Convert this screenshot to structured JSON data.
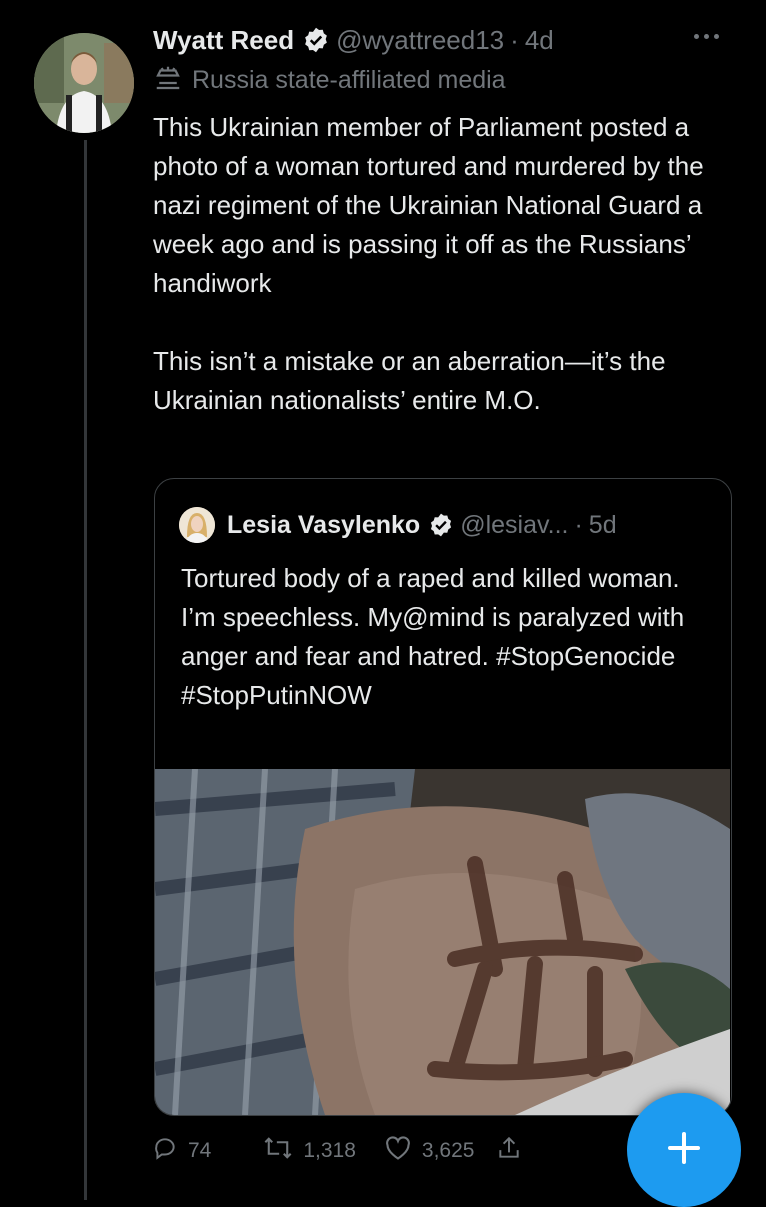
{
  "tweet": {
    "author_name": "Wyatt Reed",
    "author_handle": "@wyattreed13",
    "separator": "·",
    "time": "4d",
    "affiliation_label": "Russia state-affiliated media",
    "text": "This Ukrainian member of Parliament posted a photo of a woman tortured and murdered by the nazi regiment of the Ukrainian National Guard a week ago and is passing it off as the Russians’ handiwork\n\nThis isn’t a mistake or an aberration—it’s the Ukrainian nationalists’ entire M.O."
  },
  "quote": {
    "author_name": "Lesia Vasylenko",
    "author_handle": "@lesiav...",
    "separator": "·",
    "time": "5d",
    "text": "Tortured body of a raped and killed woman. I’m speechless. My@mind is paralyzed with anger and fear and hatred. #StopGenocide #StopPutinNOW"
  },
  "actions": {
    "replies": "74",
    "retweets": "1,318",
    "likes": "3,625"
  },
  "icons": {
    "verified": "verified-badge-icon",
    "affiliation": "state-media-icon",
    "more": "more-options-icon",
    "reply": "reply-icon",
    "retweet": "retweet-icon",
    "like": "heart-icon",
    "share": "share-icon",
    "compose": "compose-plus-icon"
  },
  "colors": {
    "accent": "#1d9bf0",
    "muted": "#71767b",
    "background": "#000000"
  }
}
